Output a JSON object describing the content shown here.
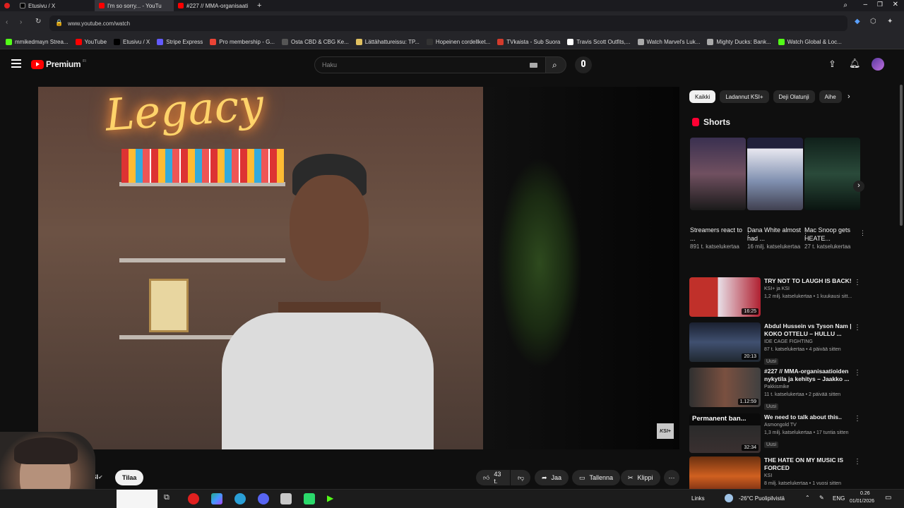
{
  "browser": {
    "tabs": [
      {
        "label": "Etusivu / X",
        "icon": "x-logo-icon",
        "color": "#000000"
      },
      {
        "label": "I'm so sorry... - YouTu",
        "icon": "youtube-icon",
        "color": "#ff0000"
      },
      {
        "label": "#227 // MMA-organisaati",
        "icon": "youtube-icon",
        "color": "#ff0000"
      }
    ],
    "url": "www.youtube.com/watch",
    "bookmarks": [
      {
        "label": "mmikedmayn Strea...",
        "color": "#53fc18"
      },
      {
        "label": "YouTube",
        "color": "#ff0000"
      },
      {
        "label": "Etusivu / X",
        "color": "#000000"
      },
      {
        "label": "Stripe Express",
        "color": "#635bff"
      },
      {
        "label": "Pro membership - G...",
        "color": "#ea4335"
      },
      {
        "label": "Osta CBD & CBG Ke...",
        "color": "#555555"
      },
      {
        "label": "Lättähattureissu: TP...",
        "color": "#e0c060"
      },
      {
        "label": "Hopeinen cordellket...",
        "color": "#333333"
      },
      {
        "label": "TVkaista - Sub Suora",
        "color": "#d33b2c"
      },
      {
        "label": "Travis Scott Outfits,...",
        "color": "#ffffff"
      },
      {
        "label": "Watch Marvel's Luk...",
        "color": "#aaaaaa"
      },
      {
        "label": "Mighty Ducks: Bank...",
        "color": "#aaaaaa"
      },
      {
        "label": "Watch Global & Loc...",
        "color": "#53fc18"
      }
    ]
  },
  "header": {
    "logo": "Premium",
    "logo_sup": "FI",
    "search_placeholder": "Haku"
  },
  "video": {
    "neon_text": "Legacy",
    "watermark": "KSI+",
    "channel_short": "KSI",
    "subscribe": "Tilaa",
    "truncated_title": "...",
    "likes": "43 t.",
    "share": "Jaa",
    "save": "Tallenna",
    "clip": "Klippi"
  },
  "chips": [
    "Kaikki",
    "Ladannut KSI+",
    "Deji Olatunji",
    "Aihe"
  ],
  "shorts": {
    "title": "Shorts",
    "items": [
      {
        "title": "Streamers react to ...",
        "views": "891 t. katselukertaa"
      },
      {
        "title": "Dana White almost had ...",
        "views": "16 milj. katselukertaa"
      },
      {
        "title": "Mac Snoop gets HEATE...",
        "views": "27 t. katselukertaa"
      }
    ]
  },
  "recommendations": [
    {
      "title": "TRY NOT TO LAUGH IS BACK!",
      "channel": "KSI+ ja KSI",
      "meta": "1,2 milj. katselukertaa • 1 kuukausi sitt...",
      "duration": "16:25",
      "badge": ""
    },
    {
      "title": "Abdul Hussein vs Tyson Nam | KOKO OTTELU – HULLU ...",
      "channel": "IDE CAGE FIGHTING",
      "meta": "87 t. katselukertaa • 4 päivää sitten",
      "duration": "20:13",
      "badge": "Uusi"
    },
    {
      "title": "#227 // MMA-organisaatioiden nykytila ja kehitys – Jaakko ...",
      "channel": "Pakkismike",
      "meta": "11 t. katselukertaa • 2 päivää sitten",
      "duration": "1.12:59",
      "badge": "Uusi"
    },
    {
      "title": "We need to talk about this..",
      "channel": "Asmongold TV",
      "meta": "1,3 milj. katselukertaa • 17 tuntia sitten",
      "duration": "32:34",
      "badge": "Uusi",
      "thumb_text": "Permanent ban..."
    },
    {
      "title": "THE HATE ON MY MUSIC IS FORCED",
      "channel": "KSI",
      "meta": "8 milj. katselukertaa • 1 vuosi sitten",
      "duration": "",
      "badge": ""
    }
  ],
  "taskbar": {
    "links": "Links",
    "weather": "-26°C Puolipilvistä",
    "lang": "ENG",
    "time": "0.26",
    "date": "01/01/2026"
  }
}
